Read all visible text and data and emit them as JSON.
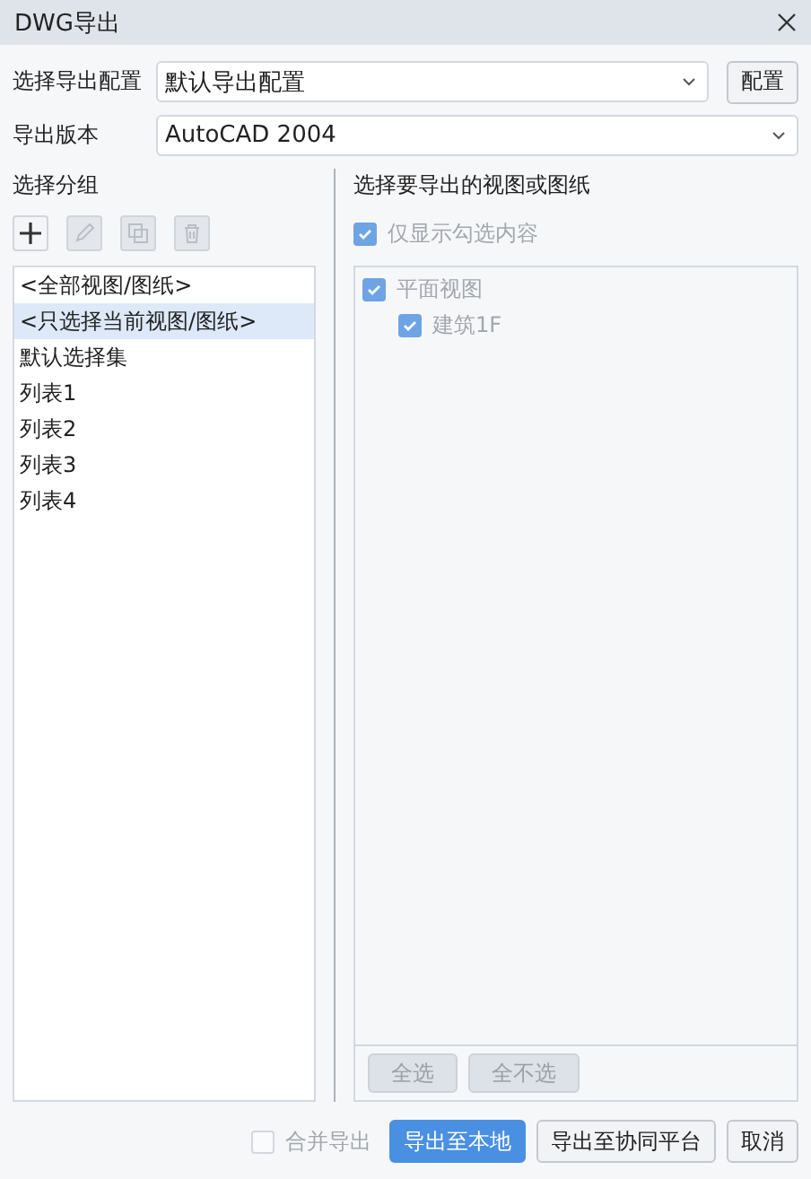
{
  "window": {
    "title": "DWG导出"
  },
  "config": {
    "label": "选择导出配置",
    "value": "默认导出配置",
    "button": "配置"
  },
  "version": {
    "label": "导出版本",
    "value": "AutoCAD 2004"
  },
  "groups": {
    "title": "选择分组",
    "tools": [
      {
        "kind": "add",
        "disabled": false
      },
      {
        "kind": "edit",
        "disabled": true
      },
      {
        "kind": "copy",
        "disabled": true
      },
      {
        "kind": "delete",
        "disabled": true
      }
    ],
    "items": [
      {
        "label": "<全部视图/图纸>",
        "selected": false
      },
      {
        "label": "<只选择当前视图/图纸>",
        "selected": true
      },
      {
        "label": "默认选择集",
        "selected": false
      },
      {
        "label": "列表1",
        "selected": false
      },
      {
        "label": "列表2",
        "selected": false
      },
      {
        "label": "列表3",
        "selected": false
      },
      {
        "label": "列表4",
        "selected": false
      }
    ]
  },
  "views": {
    "title": "选择要导出的视图或图纸",
    "filter": {
      "label": "仅显示勾选内容",
      "checked": true,
      "disabled": true
    },
    "tree": [
      {
        "label": "平面视图",
        "checked": true,
        "disabled": true,
        "children": [
          {
            "label": "建筑1F",
            "checked": true,
            "disabled": true
          }
        ]
      }
    ],
    "buttons": [
      {
        "label": "全选",
        "disabled": true
      },
      {
        "label": "全不选",
        "disabled": true
      }
    ]
  },
  "footer": {
    "merge": {
      "label": "合并导出",
      "checked": false,
      "disabled": true
    },
    "buttons": [
      {
        "label": "导出至本地",
        "primary": true
      },
      {
        "label": "导出至协同平台",
        "primary": false
      },
      {
        "label": "取消",
        "primary": false
      }
    ]
  }
}
